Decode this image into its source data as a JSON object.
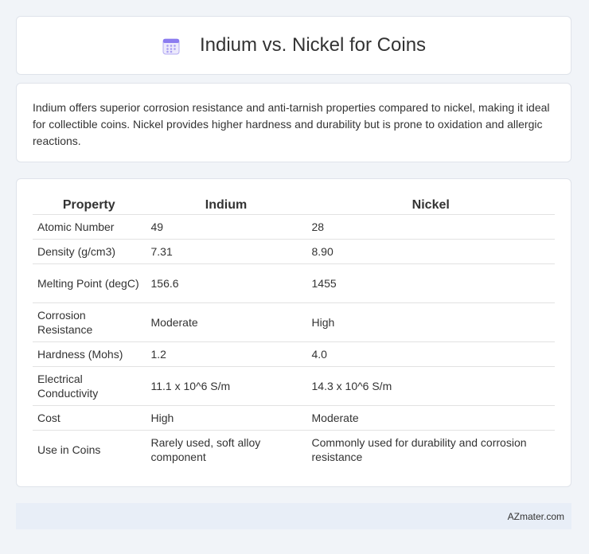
{
  "header": {
    "title": "Indium vs. Nickel for Coins",
    "icon": "calendar-icon"
  },
  "summary": {
    "text": "Indium offers superior corrosion resistance and anti-tarnish properties compared to nickel, making it ideal for collectible coins. Nickel provides higher hardness and durability but is prone to oxidation and allergic reactions."
  },
  "table": {
    "headers": [
      "Property",
      "Indium",
      "Nickel"
    ],
    "rows": [
      [
        "Atomic Number",
        "49",
        "28"
      ],
      [
        "Density (g/cm3)",
        "7.31",
        "8.90"
      ],
      [
        "Melting Point (degC)",
        "156.6",
        "1455"
      ],
      [
        "Corrosion Resistance",
        "Moderate",
        "High"
      ],
      [
        "Hardness (Mohs)",
        "1.2",
        "4.0"
      ],
      [
        "Electrical Conductivity",
        "11.1 x 10^6 S/m",
        "14.3 x 10^6 S/m"
      ],
      [
        "Cost",
        "High",
        "Moderate"
      ],
      [
        "Use in Coins",
        "Rarely used, soft alloy component",
        "Commonly used for durability and corrosion resistance"
      ]
    ]
  },
  "footer": {
    "text": "AZmater.com"
  },
  "colors": {
    "background": "#f1f4f8",
    "icon_accent": "#8b7cf0",
    "footer_bg": "#e8eef7"
  }
}
